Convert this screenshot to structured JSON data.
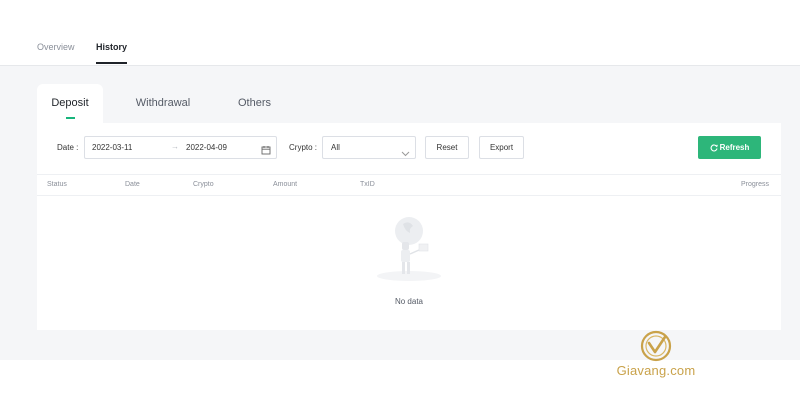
{
  "top_tabs": [
    {
      "label": "Overview",
      "active": false
    },
    {
      "label": "History",
      "active": true
    }
  ],
  "sub_tabs": [
    {
      "label": "Deposit",
      "active": true
    },
    {
      "label": "Withdrawal",
      "active": false
    },
    {
      "label": "Others",
      "active": false
    }
  ],
  "filters": {
    "date_label": "Date :",
    "start_date": "2022-03-11",
    "arrow": "→",
    "end_date": "2022-04-09",
    "crypto_label": "Crypto :",
    "crypto_value": "All",
    "reset_label": "Reset",
    "export_label": "Export",
    "refresh_label": "Refresh"
  },
  "table": {
    "columns": [
      "Status",
      "Date",
      "Crypto",
      "Amount",
      "TxID",
      "Progress"
    ]
  },
  "empty_state": {
    "text": "No data"
  },
  "watermark": {
    "brand": "Giavang.com"
  },
  "colors": {
    "accent": "#2db67a",
    "gold": "#c9a24a"
  }
}
